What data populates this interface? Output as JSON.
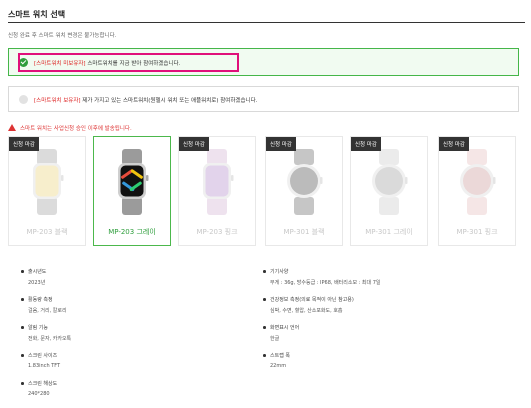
{
  "page": {
    "title": "스마트 워치 선택",
    "notice": "신청 완료 후 스마트 워치 변경은 불가능합니다."
  },
  "options": [
    {
      "tag": "[스마트워치 미보유자]",
      "text": " 스마트워치를 지금 받아 참여하겠습니다.",
      "selected": true
    },
    {
      "tag": "[스마트워치 보유자]",
      "text": " 제가 가지고 있는 스마트워치(원헬시 워치 또는 애플워치로) 참여하겠습니다.",
      "selected": false
    }
  ],
  "warning": "스마트 워치는 사업신청 승인 이후에 발송됩니다.",
  "products": [
    {
      "badge": "신청 마감",
      "name": "MP-203 블랙",
      "band_color": "#8a8a8a",
      "face_color": "#e8c85a",
      "shape": "square",
      "selected": false
    },
    {
      "badge": "",
      "name": "MP-203 그레이",
      "band_color": "#9b9b9b",
      "face_color": "#111111",
      "shape": "square",
      "selected": true
    },
    {
      "badge": "신청 마감",
      "name": "MP-203 핑크",
      "band_color": "#c9a3c9",
      "face_color": "#a070c0",
      "shape": "square",
      "selected": false
    },
    {
      "badge": "신청 마감",
      "name": "MP-301 블랙",
      "band_color": "#444444",
      "face_color": "#222222",
      "shape": "round",
      "selected": false
    },
    {
      "badge": "신청 마감",
      "name": "MP-301 그레이",
      "band_color": "#bfbfbf",
      "face_color": "#888888",
      "shape": "round",
      "selected": false
    },
    {
      "badge": "신청 마감",
      "name": "MP-301 핑크",
      "band_color": "#e0b0b0",
      "face_color": "#c08080",
      "shape": "round",
      "selected": false
    }
  ],
  "specs": {
    "left": [
      {
        "label": "출시년도",
        "value": "2023년"
      },
      {
        "label": "활동량 측정",
        "value": "걸음, 거리, 칼로리"
      },
      {
        "label": "알림 기능",
        "value": "전화, 문자, 카카오톡"
      },
      {
        "label": "스크린 사이즈",
        "value": "1.83inch TFT"
      },
      {
        "label": "스크린 해상도",
        "value": "240*280"
      }
    ],
    "right": [
      {
        "label": "기기사양",
        "value": "무게 : 36g, 방수등급 : IP68, 배터리소모 : 최대 7일"
      },
      {
        "label": "건강정보 측정(의료 목적이 아닌 참고용)",
        "value": "심박, 수면, 혈압, 산소포화도, 호흡"
      },
      {
        "label": "화면표시 언어",
        "value": "한글"
      },
      {
        "label": "스트랩 폭",
        "value": "22mm"
      }
    ]
  }
}
